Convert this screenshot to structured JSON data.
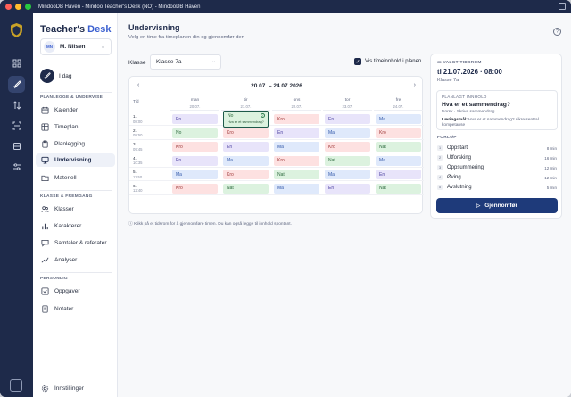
{
  "titlebar": {
    "title": "MindooDB Haven - Mindoo Teacher's Desk (NO) - MindooDB Haven"
  },
  "brand": {
    "a": "Teacher's ",
    "b": "Desk"
  },
  "user": {
    "initials": "MN",
    "name": "M. Nilsen"
  },
  "sidebar": {
    "today": "I dag",
    "sections": [
      "PLANLEGGE & UNDERVISE",
      "KLASSE & FREMGANG",
      "PERSONLIG"
    ],
    "items": [
      "Kalender",
      "Timeplan",
      "Planlegging",
      "Undervisning",
      "Materiell",
      "Klasser",
      "Karakterer",
      "Samtaler & referater",
      "Analyser",
      "Oppgaver",
      "Notater"
    ],
    "settings": "Innstillinger"
  },
  "main": {
    "title": "Undervisning",
    "subtitle": "Velg en time fra timeplanen din og gjennomfør den",
    "class_label": "Klasse",
    "class_value": "Klasse 7a",
    "show_content_label": "Vis timeinnhold i planen",
    "week_range": "20.07. – 24.07.2026",
    "tid": "Tid",
    "days": [
      {
        "d": "man",
        "dt": "20.07."
      },
      {
        "d": "tir",
        "dt": "21.07."
      },
      {
        "d": "ons",
        "dt": "22.07."
      },
      {
        "d": "tor",
        "dt": "23.07."
      },
      {
        "d": "fre",
        "dt": "24.07."
      }
    ],
    "periods": [
      {
        "n": "1.",
        "t": "08:00"
      },
      {
        "n": "2.",
        "t": "08:50"
      },
      {
        "n": "3.",
        "t": "09:45"
      },
      {
        "n": "4.",
        "t": "10:35"
      },
      {
        "n": "5.",
        "t": "11:50"
      },
      {
        "n": "6.",
        "t": "12:40"
      }
    ],
    "grid": [
      [
        "En",
        "No",
        "Kro",
        "En",
        "Ma"
      ],
      [
        "No",
        "Kro",
        "En",
        "Ma",
        "Kro"
      ],
      [
        "Kro",
        "En",
        "Ma",
        "Kro",
        "Nat"
      ],
      [
        "En",
        "Ma",
        "Kro",
        "Nat",
        "Ma"
      ],
      [
        "Ma",
        "Kro",
        "Nat",
        "Ma",
        "En"
      ],
      [
        "Kro",
        "Nat",
        "Ma",
        "En",
        "Nat"
      ]
    ],
    "selected_content": "Hva er et sammendrag?",
    "hint": "Klikk på et tidsrom for å gjennomføre timen. Du kan også legge til innhold spontant."
  },
  "panel": {
    "kicker": "VALGT TIDSROM",
    "date": "ti 21.07.2026 · 08:00",
    "klass": "Klasse 7a",
    "planned_label": "PLANLAGT INNHOLD",
    "question": "Hva er et sammendrag?",
    "subject": "Norsk · Skrive sammendrag",
    "goal_label": "Læringsmål:",
    "goal_text": " Hva er et sammendrag? sikre sentral kompetanse",
    "flow_label": "FORLØP",
    "steps": [
      {
        "n": "1",
        "name": "Oppstart",
        "min": "8 min"
      },
      {
        "n": "2",
        "name": "Utforsking",
        "min": "16 min"
      },
      {
        "n": "3",
        "name": "Oppsummering",
        "min": "12 min"
      },
      {
        "n": "4",
        "name": "Øving",
        "min": "12 min"
      },
      {
        "n": "5",
        "name": "Avslutning",
        "min": "5 min"
      }
    ],
    "go_button": "Gjennomfør"
  }
}
